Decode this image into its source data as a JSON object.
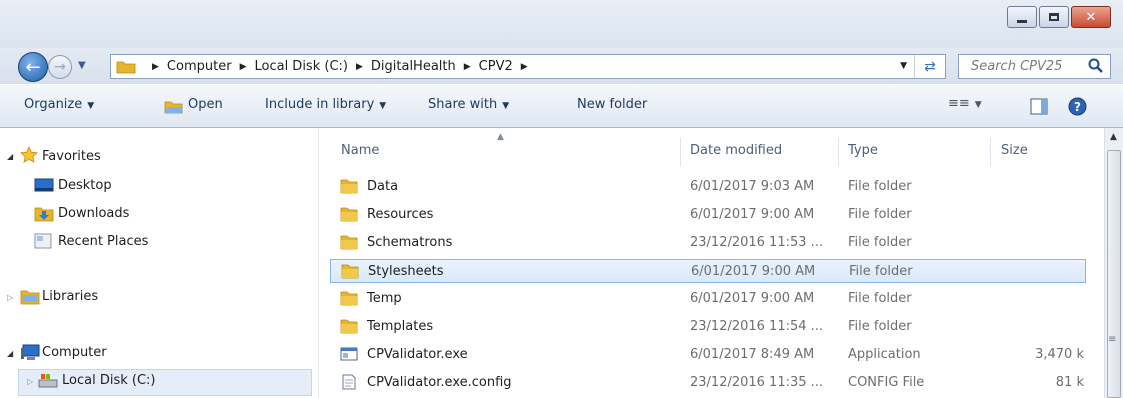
{
  "window": {
    "minimize_icon": "minimize-icon",
    "maximize_icon": "maximize-icon",
    "close_label": "✕"
  },
  "breadcrumb": [
    "Computer",
    "Local Disk (C:)",
    "DigitalHealth",
    "CPV2"
  ],
  "search": {
    "placeholder": "Search CPV25"
  },
  "toolbar": {
    "organize": "Organize",
    "open": "Open",
    "include": "Include in library",
    "share": "Share with",
    "new_folder": "New folder"
  },
  "nav": {
    "favorites": "Favorites",
    "desktop": "Desktop",
    "downloads": "Downloads",
    "recent": "Recent Places",
    "libraries": "Libraries",
    "computer": "Computer",
    "localdisk": "Local Disk (C:)"
  },
  "columns": {
    "name": "Name",
    "date": "Date modified",
    "type": "Type",
    "size": "Size"
  },
  "files": [
    {
      "name": "Data",
      "date": "6/01/2017 9:03 AM",
      "type": "File folder",
      "size": "",
      "icon": "folder-icon"
    },
    {
      "name": "Resources",
      "date": "6/01/2017 9:00 AM",
      "type": "File folder",
      "size": "",
      "icon": "folder-icon"
    },
    {
      "name": "Schematrons",
      "date": "23/12/2016 11:53 ...",
      "type": "File folder",
      "size": "",
      "icon": "folder-icon"
    },
    {
      "name": "Stylesheets",
      "date": "6/01/2017 9:00 AM",
      "type": "File folder",
      "size": "",
      "icon": "folder-icon",
      "selected": true
    },
    {
      "name": "Temp",
      "date": "6/01/2017 9:00 AM",
      "type": "File folder",
      "size": "",
      "icon": "folder-icon"
    },
    {
      "name": "Templates",
      "date": "23/12/2016 11:54 ...",
      "type": "File folder",
      "size": "",
      "icon": "folder-icon"
    },
    {
      "name": "CPValidator.exe",
      "date": "6/01/2017 8:49 AM",
      "type": "Application",
      "size": "3,470 k",
      "icon": "application-icon"
    },
    {
      "name": "CPValidator.exe.config",
      "date": "23/12/2016 11:35 ...",
      "type": "CONFIG File",
      "size": "81 k",
      "icon": "config-file-icon"
    }
  ],
  "colors": {
    "selection": "#d9e8f9",
    "accent": "#1e395b",
    "folder": "#e8b52a"
  }
}
